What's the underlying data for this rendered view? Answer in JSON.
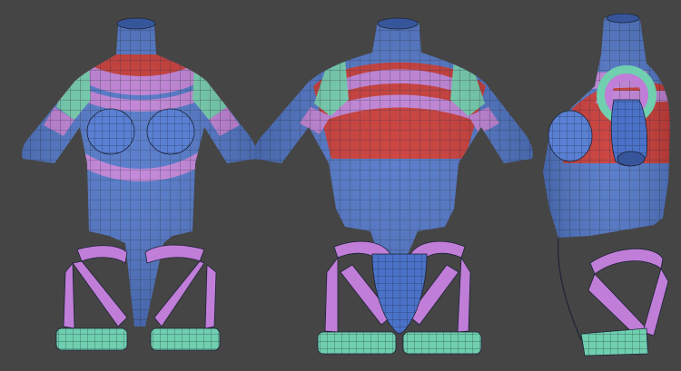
{
  "viewport": {
    "background": "#454545",
    "wire_color": "#1a2233"
  },
  "palette": {
    "blue": "#4a72c8",
    "blue_light": "#6a8fdc",
    "red": "#c8322e",
    "violet": "#c07ed8",
    "teal": "#6fcfae",
    "dark_line": "#1d2336"
  },
  "figures": [
    {
      "name": "front-view"
    },
    {
      "name": "back-view"
    },
    {
      "name": "side-view"
    }
  ]
}
